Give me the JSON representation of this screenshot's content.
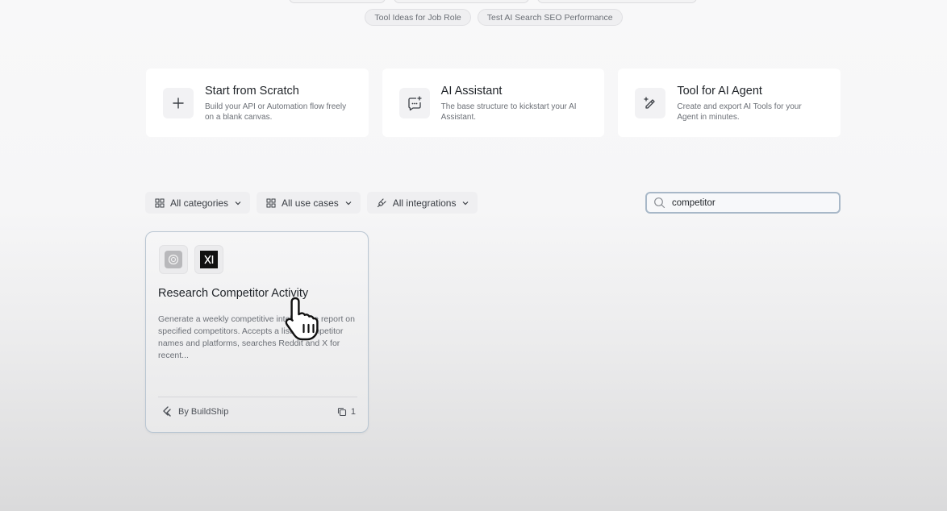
{
  "suggestions": [
    "Tool Ideas for Job Role",
    "Test AI Search SEO Performance"
  ],
  "start_cards": [
    {
      "title": "Start from Scratch",
      "desc": "Build your API or Automation flow freely on a blank canvas.",
      "icon": "plus-icon"
    },
    {
      "title": "AI Assistant",
      "desc": "The base structure to kickstart your AI Assistant.",
      "icon": "chat-sparkle-icon"
    },
    {
      "title": "Tool for AI Agent",
      "desc": "Create and export AI Tools for your Agent in minutes.",
      "icon": "wand-icon"
    }
  ],
  "filters": {
    "categories": "All categories",
    "use_cases": "All use cases",
    "integrations": "All integrations"
  },
  "search": {
    "value": "competitor"
  },
  "template": {
    "title": "Research Competitor Activity",
    "desc": "Generate a weekly competitive intelligence report on specified competitors. Accepts a list of competitor names and platforms, searches Reddit and X for recent...",
    "author": "By BuildShip",
    "count": "1",
    "integrations": [
      "openai-icon",
      "xai-icon"
    ]
  },
  "colors": {
    "accent_border": "#a8b8c8"
  }
}
